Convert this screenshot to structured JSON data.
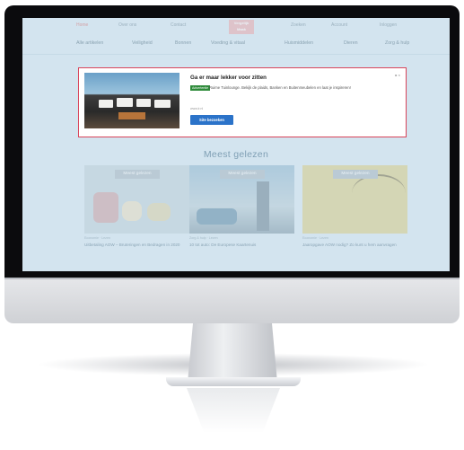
{
  "site": {
    "logo_lines": [
      "Vergelijk",
      "Maak"
    ],
    "topbar": [
      "Home",
      "Over ons",
      "Contact",
      "Zoeken",
      "Account",
      "Inloggen"
    ],
    "nav": [
      "Alle artikelen",
      "Veiligheid",
      "Bonnen",
      "Voeding & vitaal",
      "Huismiddelen",
      "Dieren",
      "Zorg & hulp"
    ]
  },
  "ad": {
    "title": "Ga er maar lekker voor zitten",
    "badge": "Advertentie",
    "text": "Ruime Tuinlounge. Bekijk de plaids, Banken en Buitenmeubelen en laat je inspireren!",
    "url": "www.lr.nl",
    "button": "Site bezoeken",
    "close": "▸ ×"
  },
  "section": {
    "title": "Meest gelezen"
  },
  "cards": [
    {
      "label": "Meest gelezen",
      "category": "Economie · Lezen",
      "title": "Uitbetaling AOW – Bruteringen en Bedragen in 2020",
      "color": "#bdcfd9"
    },
    {
      "label": "Meest gelezen",
      "category": "Zorg & hulp · Lezen",
      "title": "10 tot auto: De Europese Kaartenuis",
      "color": "#9fbdd0"
    },
    {
      "label": "Meest gelezen",
      "category": "Economie · Lezen",
      "title": "Jaaropgave AOW nodig? Zo kunt u hem aanvragen",
      "color": "#d6cc86"
    }
  ]
}
